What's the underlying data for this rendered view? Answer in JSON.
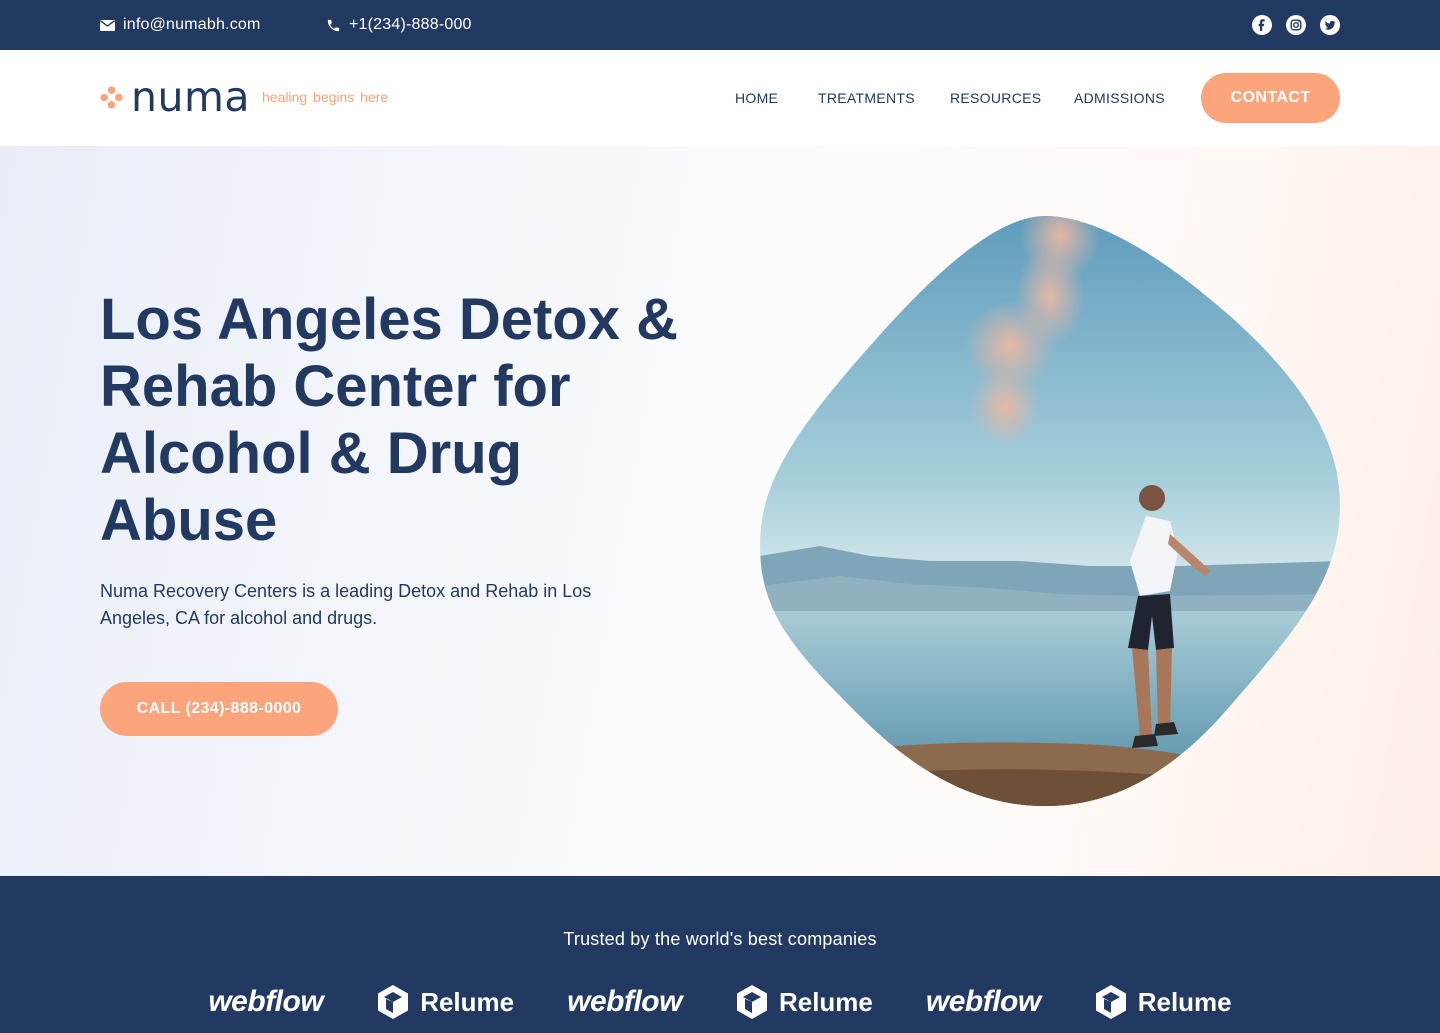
{
  "topbar": {
    "email": "info@numabh.com",
    "phone": "+1(234)-888-000",
    "social_icons": [
      "facebook-icon",
      "instagram-icon",
      "twitter-icon"
    ]
  },
  "header": {
    "logo_text": "numa",
    "tagline": "healing begins here",
    "nav": {
      "home": "HOME",
      "treatments": "TREATMENTS",
      "resources": "RESOURCES",
      "admissions": "ADMISSIONS"
    },
    "contact_label": "CONTACT"
  },
  "hero": {
    "title": "Los Angeles Detox & Rehab Center for Alcohol & Drug Abuse",
    "description": "Numa Recovery Centers is a leading Detox and Rehab in Los Angeles, CA for alcohol and drugs.",
    "cta_label": "CALL (234)-888-0000"
  },
  "trusted": {
    "title": "Trusted by the world's best companies",
    "logos": [
      "webflow",
      "Relume",
      "webflow",
      "Relume",
      "webflow",
      "Relume"
    ]
  },
  "colors": {
    "navy": "#223961",
    "accent": "#fca47b",
    "white": "#ffffff"
  }
}
